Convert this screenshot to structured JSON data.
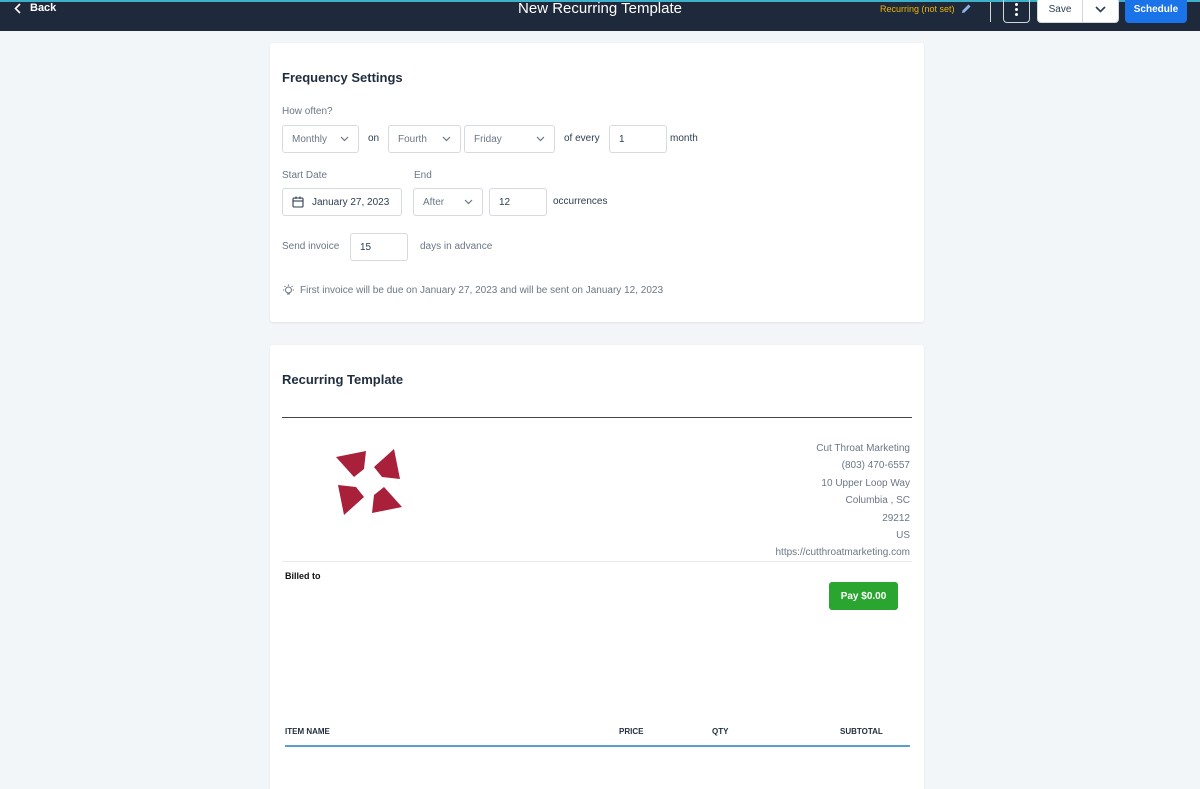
{
  "header": {
    "back_label": "Back",
    "title": "New Recurring Template",
    "recurring_status": "Recurring (not set)",
    "save_label": "Save",
    "schedule_label": "Schedule"
  },
  "frequency": {
    "title": "Frequency Settings",
    "how_often_label": "How often?",
    "interval_value": "Monthly",
    "on_label": "on",
    "week_value": "Fourth",
    "day_value": "Friday",
    "of_every_label": "of every",
    "every_count": "1",
    "unit_label": "month",
    "start_date_label": "Start Date",
    "start_date_value": "January 27, 2023",
    "end_label": "End",
    "end_value": "After",
    "occurrences_count": "12",
    "occurrences_label": "occurrences",
    "send_invoice_label": "Send invoice",
    "days_advance_value": "15",
    "days_advance_label": "days in advance",
    "note": "First invoice will be due on January 27, 2023 and will be sent on January 12, 2023"
  },
  "template": {
    "title": "Recurring Template",
    "company": {
      "name": "Cut Throat Marketing",
      "phone": "(803) 470-6557",
      "street": "10 Upper Loop Way",
      "city_state": "Columbia , SC",
      "zip": "29212",
      "country": "US",
      "website": "https://cutthroatmarketing.com"
    },
    "billed_to_label": "Billed to",
    "pay_label": "Pay $0.00",
    "columns": {
      "item": "ITEM NAME",
      "price": "PRICE",
      "qty": "QTY",
      "subtotal": "SUBTOTAL"
    }
  },
  "colors": {
    "topbar": "#1e293b",
    "accent_blue": "#1a73e8",
    "pay_green": "#2aa52f",
    "status_amber": "#f0b400",
    "logo_red": "#a8203a"
  },
  "icons": [
    "chevron-left-icon",
    "pencil-icon",
    "kebab-menu-icon",
    "chevron-down-icon",
    "calendar-icon",
    "lightbulb-icon"
  ]
}
